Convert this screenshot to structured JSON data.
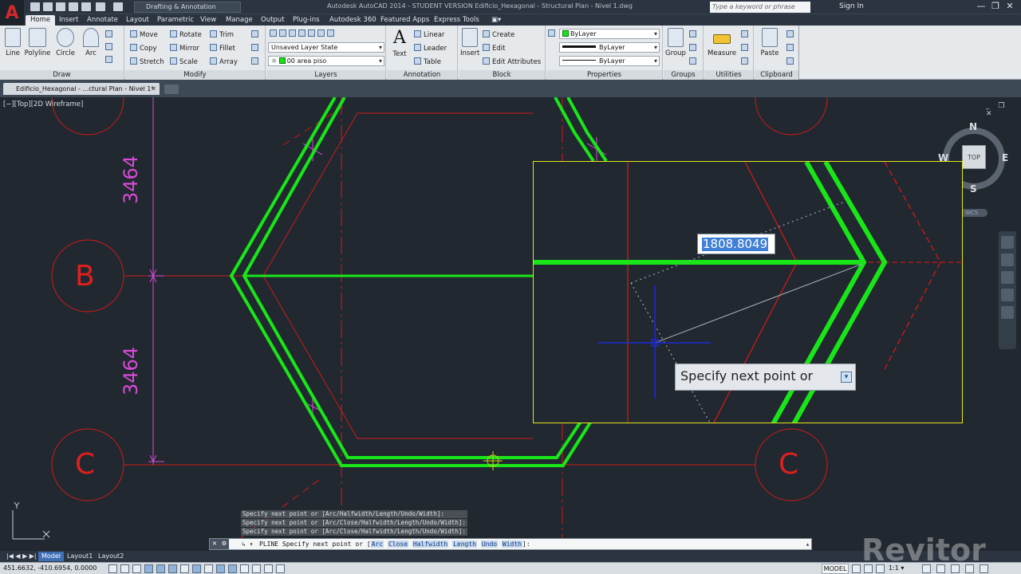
{
  "window": {
    "title": "Autodesk AutoCAD 2014 - STUDENT VERSION   Edificio_Hexagonal - Structural Plan - Nivel 1.dwg",
    "workspace": "Drafting & Annotation",
    "search_placeholder": "Type a keyword or phrase",
    "signin": "Sign In",
    "logo": "A",
    "controls": {
      "minimize": "—",
      "restore": "❐",
      "close": "✕"
    }
  },
  "tabs": [
    "Home",
    "Insert",
    "Annotate",
    "Layout",
    "Parametric",
    "View",
    "Manage",
    "Output",
    "Plug-ins",
    "Autodesk 360",
    "Featured Apps",
    "Express Tools",
    "▣▾"
  ],
  "ribbon": {
    "draw": {
      "title": "Draw",
      "tools": [
        "Line",
        "Polyline",
        "Circle",
        "Arc"
      ]
    },
    "modify": {
      "title": "Modify",
      "items": [
        "Move",
        "Rotate",
        "Trim",
        "Copy",
        "Mirror",
        "Fillet",
        "Stretch",
        "Scale",
        "Array"
      ]
    },
    "layers": {
      "title": "Layers",
      "state": "Unsaved Layer State",
      "current": "00 area piso"
    },
    "annotation": {
      "title": "Annotation",
      "text": "Text",
      "items": [
        "Linear",
        "Leader",
        "Table"
      ]
    },
    "block": {
      "title": "Block",
      "insert": "Insert",
      "items": [
        "Create",
        "Edit",
        "Edit Attributes"
      ]
    },
    "properties": {
      "title": "Properties",
      "color": "ByLayer",
      "linetype": "ByLayer",
      "lineweight": "ByLayer"
    },
    "groups": {
      "title": "Groups",
      "group": "Group"
    },
    "utilities": {
      "title": "Utilities",
      "measure": "Measure"
    },
    "clipboard": {
      "title": "Clipboard",
      "paste": "Paste"
    }
  },
  "document": {
    "tab": "Edificio_Hexagonal - ...ctural Plan - Nivel 1*",
    "close": "✕"
  },
  "viewport": {
    "label": "[−][Top][2D Wireframe]",
    "controls": "_ ❐ ✕"
  },
  "viewcube": {
    "n": "N",
    "s": "S",
    "e": "E",
    "w": "W",
    "top": "TOP",
    "wcs": "WCS"
  },
  "drawing": {
    "dim_top": "3464",
    "dim_bottom": "3464",
    "grid_labels": [
      "B",
      "C",
      "C"
    ],
    "line_color": "#19e619",
    "grid_color": "#d11d1d",
    "dim_color": "#d84bd8"
  },
  "magnifier": {
    "length_input": "1808.8049",
    "prompt": "Specify next point or",
    "prompt_icon": "▾"
  },
  "command": {
    "history": [
      "Specify next point or [Arc/Halfwidth/Length/Undo/Width]:",
      "Specify next point or [Arc/Close/Halfwidth/Length/Undo/Width]:",
      "Specify next point or [Arc/Close/Halfwidth/Length/Undo/Width]:"
    ],
    "prefix": "PLINE Specify next point or [",
    "options": [
      "Arc",
      "Close",
      "Halfwidth",
      "Length",
      "Undo",
      "Width"
    ],
    "suffix": "]:",
    "close": "✕",
    "wrench": "⚙",
    "dropdown": "↳ ▾"
  },
  "layout_tabs": [
    "Model",
    "Layout1",
    "Layout2"
  ],
  "status": {
    "coords": "451.6632, -410.6954, 0.0000",
    "model": "MODEL",
    "scale": "1:1 ▾"
  },
  "watermark": "Revitor"
}
